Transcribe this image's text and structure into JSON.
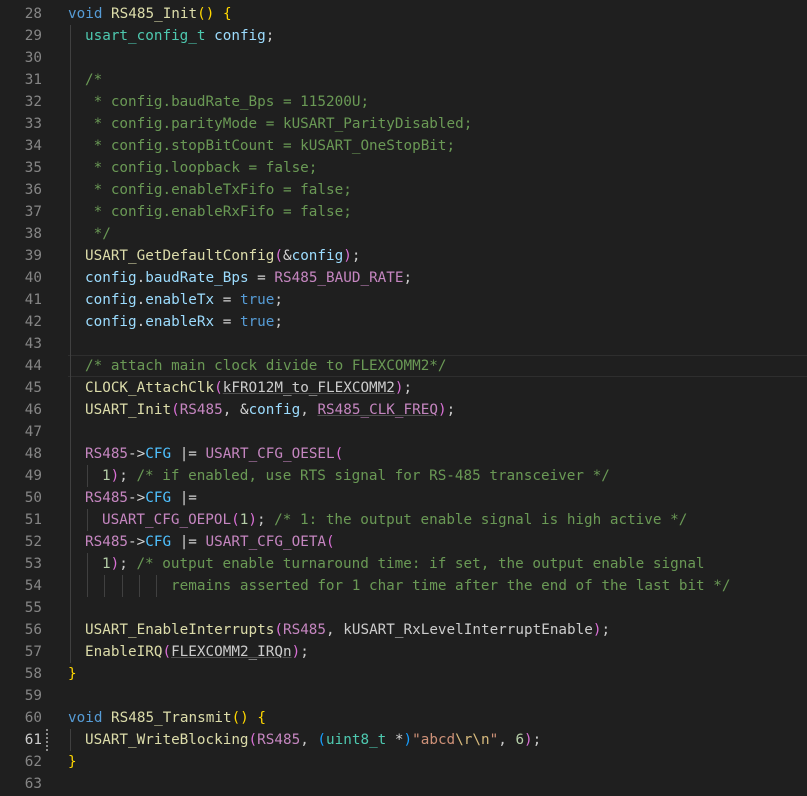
{
  "editor": {
    "active_line": 61,
    "lines": [
      {
        "n": 28,
        "indent": 0,
        "tokens": [
          [
            "void",
            "kw"
          ],
          [
            " ",
            "pl"
          ],
          [
            "RS485_Init",
            "fn"
          ],
          [
            "()",
            "br1"
          ],
          [
            " ",
            "pl"
          ],
          [
            "{",
            "br1"
          ]
        ]
      },
      {
        "n": 29,
        "indent": 1,
        "tokens": [
          [
            "usart_config_t",
            "ty"
          ],
          [
            " ",
            "pl"
          ],
          [
            "config",
            "var"
          ],
          [
            ";",
            "pl"
          ]
        ]
      },
      {
        "n": 30,
        "indent": 1,
        "tokens": []
      },
      {
        "n": 31,
        "indent": 1,
        "tokens": [
          [
            "/*",
            "cm"
          ]
        ]
      },
      {
        "n": 32,
        "indent": 1,
        "tokens": [
          [
            " * config.baudRate_Bps = 115200U;",
            "cm"
          ]
        ]
      },
      {
        "n": 33,
        "indent": 1,
        "tokens": [
          [
            " * config.parityMode = kUSART_ParityDisabled;",
            "cm"
          ]
        ]
      },
      {
        "n": 34,
        "indent": 1,
        "tokens": [
          [
            " * config.stopBitCount = kUSART_OneStopBit;",
            "cm"
          ]
        ]
      },
      {
        "n": 35,
        "indent": 1,
        "tokens": [
          [
            " * config.loopback = false;",
            "cm"
          ]
        ]
      },
      {
        "n": 36,
        "indent": 1,
        "tokens": [
          [
            " * config.enableTxFifo = false;",
            "cm"
          ]
        ]
      },
      {
        "n": 37,
        "indent": 1,
        "tokens": [
          [
            " * config.enableRxFifo = false;",
            "cm"
          ]
        ]
      },
      {
        "n": 38,
        "indent": 1,
        "tokens": [
          [
            " */",
            "cm"
          ]
        ]
      },
      {
        "n": 39,
        "indent": 1,
        "tokens": [
          [
            "USART_GetDefaultConfig",
            "fn"
          ],
          [
            "(",
            "br2"
          ],
          [
            "&",
            "op"
          ],
          [
            "config",
            "var"
          ],
          [
            ")",
            "br2"
          ],
          [
            ";",
            "pl"
          ]
        ]
      },
      {
        "n": 40,
        "indent": 1,
        "tokens": [
          [
            "config",
            "var"
          ],
          [
            ".",
            "pl"
          ],
          [
            "baudRate_Bps",
            "var"
          ],
          [
            " = ",
            "op"
          ],
          [
            "RS485_BAUD_RATE",
            "mac"
          ],
          [
            ";",
            "pl"
          ]
        ]
      },
      {
        "n": 41,
        "indent": 1,
        "tokens": [
          [
            "config",
            "var"
          ],
          [
            ".",
            "pl"
          ],
          [
            "enableTx",
            "var"
          ],
          [
            " = ",
            "op"
          ],
          [
            "true",
            "kw"
          ],
          [
            ";",
            "pl"
          ]
        ]
      },
      {
        "n": 42,
        "indent": 1,
        "tokens": [
          [
            "config",
            "var"
          ],
          [
            ".",
            "pl"
          ],
          [
            "enableRx",
            "var"
          ],
          [
            " = ",
            "op"
          ],
          [
            "true",
            "kw"
          ],
          [
            ";",
            "pl"
          ]
        ]
      },
      {
        "n": 43,
        "indent": 1,
        "tokens": []
      },
      {
        "n": 44,
        "indent": 1,
        "tokens": [
          [
            "/* attach main clock divide to FLEXCOMM2*/",
            "cm"
          ]
        ]
      },
      {
        "n": 45,
        "indent": 1,
        "tokens": [
          [
            "CLOCK_AttachClk",
            "fn"
          ],
          [
            "(",
            "br2"
          ],
          [
            "kFRO12M_to_FLEXCOMM2",
            "pl",
            "ul"
          ],
          [
            ")",
            "br2"
          ],
          [
            ";",
            "pl"
          ]
        ]
      },
      {
        "n": 46,
        "indent": 1,
        "tokens": [
          [
            "USART_Init",
            "fn"
          ],
          [
            "(",
            "br2"
          ],
          [
            "RS485",
            "mac"
          ],
          [
            ", ",
            "pl"
          ],
          [
            "&",
            "op"
          ],
          [
            "config",
            "var"
          ],
          [
            ", ",
            "pl"
          ],
          [
            "RS485_CLK_FREQ",
            "mac",
            "ul"
          ],
          [
            ")",
            "br2"
          ],
          [
            ";",
            "pl"
          ]
        ]
      },
      {
        "n": 47,
        "indent": 1,
        "tokens": []
      },
      {
        "n": 48,
        "indent": 1,
        "tokens": [
          [
            "RS485",
            "mac"
          ],
          [
            "->",
            "op"
          ],
          [
            "CFG",
            "mac2"
          ],
          [
            " |= ",
            "op"
          ],
          [
            "USART_CFG_OESEL",
            "mac"
          ],
          [
            "(",
            "br2"
          ]
        ]
      },
      {
        "n": 49,
        "indent": 2,
        "tokens": [
          [
            "1",
            "num"
          ],
          [
            ")",
            "br2"
          ],
          [
            "; ",
            "pl"
          ],
          [
            "/* if enabled, use RTS signal for RS-485 transceiver */",
            "cm"
          ]
        ]
      },
      {
        "n": 50,
        "indent": 1,
        "tokens": [
          [
            "RS485",
            "mac"
          ],
          [
            "->",
            "op"
          ],
          [
            "CFG",
            "mac2"
          ],
          [
            " |=",
            "op"
          ]
        ]
      },
      {
        "n": 51,
        "indent": 2,
        "tokens": [
          [
            "USART_CFG_OEPOL",
            "mac"
          ],
          [
            "(",
            "br2"
          ],
          [
            "1",
            "num"
          ],
          [
            ")",
            "br2"
          ],
          [
            "; ",
            "pl"
          ],
          [
            "/* 1: the output enable signal is high active */",
            "cm"
          ]
        ]
      },
      {
        "n": 52,
        "indent": 1,
        "tokens": [
          [
            "RS485",
            "mac"
          ],
          [
            "->",
            "op"
          ],
          [
            "CFG",
            "mac2"
          ],
          [
            " |= ",
            "op"
          ],
          [
            "USART_CFG_OETA",
            "mac"
          ],
          [
            "(",
            "br2"
          ]
        ]
      },
      {
        "n": 53,
        "indent": 2,
        "tokens": [
          [
            "1",
            "num"
          ],
          [
            ")",
            "br2"
          ],
          [
            "; ",
            "pl"
          ],
          [
            "/* output enable turnaround time: if set, the output enable signal",
            "cm"
          ]
        ]
      },
      {
        "n": 54,
        "indent": 6,
        "tokens": [
          [
            "remains asserted for 1 char time after the end of the last bit */",
            "cm"
          ]
        ]
      },
      {
        "n": 55,
        "indent": 1,
        "tokens": []
      },
      {
        "n": 56,
        "indent": 1,
        "tokens": [
          [
            "USART_EnableInterrupts",
            "fn"
          ],
          [
            "(",
            "br2"
          ],
          [
            "RS485",
            "mac"
          ],
          [
            ", ",
            "pl"
          ],
          [
            "kUSART_RxLevelInterruptEnable",
            "pl"
          ],
          [
            ")",
            "br2"
          ],
          [
            ";",
            "pl"
          ]
        ]
      },
      {
        "n": 57,
        "indent": 1,
        "tokens": [
          [
            "EnableIRQ",
            "fn"
          ],
          [
            "(",
            "br2"
          ],
          [
            "FLEXCOMM2_IRQn",
            "pl",
            "ul"
          ],
          [
            ")",
            "br2"
          ],
          [
            ";",
            "pl"
          ]
        ]
      },
      {
        "n": 58,
        "indent": 0,
        "tokens": [
          [
            "}",
            "br1"
          ]
        ]
      },
      {
        "n": 59,
        "indent": 0,
        "tokens": []
      },
      {
        "n": 60,
        "indent": 0,
        "tokens": [
          [
            "void",
            "kw"
          ],
          [
            " ",
            "pl"
          ],
          [
            "RS485_Transmit",
            "fn"
          ],
          [
            "()",
            "br1"
          ],
          [
            " ",
            "pl"
          ],
          [
            "{",
            "br1"
          ]
        ]
      },
      {
        "n": 61,
        "indent": 1,
        "tokens": [
          [
            "USART_WriteBlocking",
            "fn"
          ],
          [
            "(",
            "br2"
          ],
          [
            "RS485",
            "mac"
          ],
          [
            ", ",
            "pl"
          ],
          [
            "(",
            "br3"
          ],
          [
            "uint8_t",
            "ty"
          ],
          [
            " *",
            "op"
          ],
          [
            ")",
            "br3"
          ],
          [
            "\"abcd",
            "str"
          ],
          [
            "\\r\\n",
            "esc"
          ],
          [
            "\"",
            "str"
          ],
          [
            ", ",
            "pl"
          ],
          [
            "6",
            "num"
          ],
          [
            ")",
            "br2"
          ],
          [
            ";",
            "pl"
          ]
        ]
      },
      {
        "n": 62,
        "indent": 0,
        "tokens": [
          [
            "}",
            "br1"
          ]
        ]
      },
      {
        "n": 63,
        "indent": 0,
        "tokens": []
      }
    ]
  }
}
